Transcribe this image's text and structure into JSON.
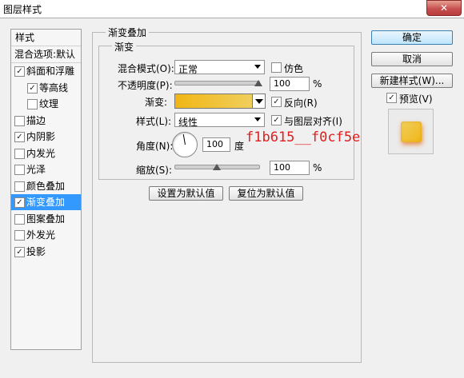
{
  "window": {
    "title": "图层样式",
    "close_glyph": "✕"
  },
  "sidebar": {
    "header": "样式",
    "blend_options": "混合选项:默认",
    "items": [
      {
        "label": "斜面和浮雕",
        "checked": true
      },
      {
        "label": "等高线",
        "checked": true
      },
      {
        "label": "纹理",
        "checked": false
      },
      {
        "label": "描边",
        "checked": false
      },
      {
        "label": "内阴影",
        "checked": true
      },
      {
        "label": "内发光",
        "checked": false
      },
      {
        "label": "光泽",
        "checked": false
      },
      {
        "label": "颜色叠加",
        "checked": false
      },
      {
        "label": "渐变叠加",
        "checked": true,
        "selected": true
      },
      {
        "label": "图案叠加",
        "checked": false
      },
      {
        "label": "外发光",
        "checked": false
      },
      {
        "label": "投影",
        "checked": true
      }
    ]
  },
  "panel": {
    "group_title": "渐变叠加",
    "subgroup_title": "渐变",
    "blend_mode": {
      "label": "混合模式(O):",
      "value": "正常"
    },
    "dither": {
      "label": "仿色",
      "checked": false
    },
    "opacity": {
      "label": "不透明度(P):",
      "value": "100",
      "unit": "%",
      "level": 1.0
    },
    "gradient": {
      "label": "渐变:",
      "colors": [
        "#f1b615",
        "#f0cf5e"
      ]
    },
    "reverse": {
      "label": "反向(R)",
      "checked": true
    },
    "style": {
      "label": "样式(L):",
      "value": "线性"
    },
    "align": {
      "label": "与图层对齐(I)",
      "checked": true
    },
    "angle": {
      "label": "角度(N):",
      "value": "100",
      "unit": "度"
    },
    "scale": {
      "label": "缩放(S):",
      "value": "100",
      "unit": "%",
      "level": 0.5
    },
    "annotation": "f1b615__f0cf5e",
    "set_default": "设置为默认值",
    "reset_default": "复位为默认值"
  },
  "buttons": {
    "ok": "确定",
    "cancel": "取消",
    "new_style": "新建样式(W)...",
    "preview": {
      "label": "预览(V)",
      "checked": true
    }
  }
}
